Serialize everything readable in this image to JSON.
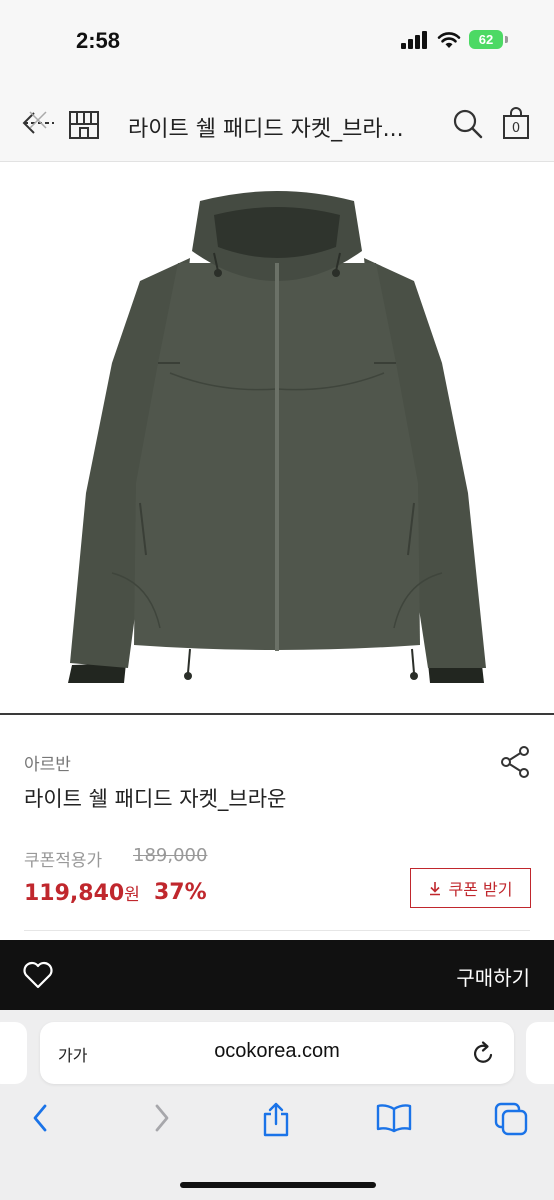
{
  "status": {
    "time": "2:58",
    "battery": "62",
    "battery_color": "#4cd964"
  },
  "header": {
    "title": "라이트 쉘 패디드 자켓_브라...",
    "icons": [
      "back-close-icon",
      "store-icon",
      "search-icon",
      "cart-icon"
    ],
    "cart_count": "0"
  },
  "product": {
    "brand": "아르반",
    "name": "라이트 쉘 패디드 자켓_브라운",
    "coupon_price_label": "쿠폰적용가",
    "original_price": "189,000",
    "sale_price": "119,840",
    "currency": "원",
    "discount": "37%",
    "coupon_button": "쿠폰 받기",
    "accent_color": "#c0272d"
  },
  "buy_bar": {
    "label": "구매하기"
  },
  "browser": {
    "text_size_label": "가가",
    "url": "ocokorea.com",
    "toolbar_icons": [
      "back-icon",
      "forward-icon",
      "share-icon",
      "bookmarks-icon",
      "tabs-icon"
    ]
  }
}
